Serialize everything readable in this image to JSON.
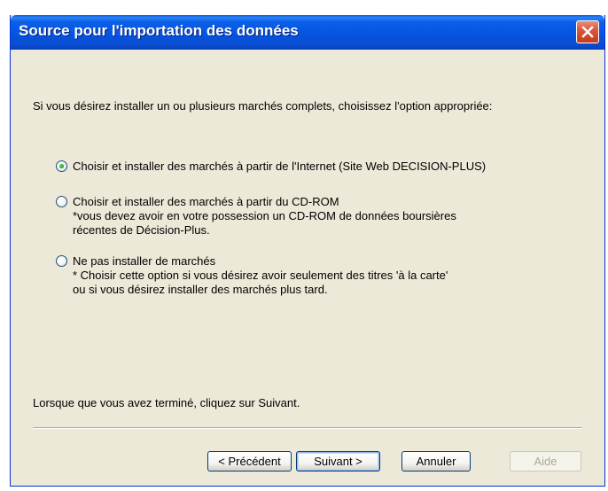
{
  "window": {
    "title": "Source pour l'importation des données"
  },
  "intro_text": "Si vous désirez installer un ou plusieurs marchés complets, choisissez l'option appropriée:",
  "options": [
    {
      "label": "Choisir et installer des marchés à partir de l'Internet (Site Web DECISION-PLUS)",
      "checked": true,
      "notes": []
    },
    {
      "label": "Choisir et installer des marchés à partir du CD-ROM",
      "checked": false,
      "notes": [
        "*vous devez avoir en votre possession un CD-ROM de données boursières",
        "récentes de Décision-Plus."
      ]
    },
    {
      "label": "Ne pas installer de marchés",
      "checked": false,
      "notes": [
        "* Choisir cette option si vous désirez avoir seulement des titres 'à la carte'",
        "ou si vous désirez installer des marchés plus tard."
      ]
    }
  ],
  "footer_text": "Lorsque que vous avez terminé, cliquez sur Suivant.",
  "buttons": {
    "previous": "< Précédent",
    "next": "Suivant >",
    "cancel": "Annuler",
    "help": "Aide"
  },
  "colors": {
    "titlebar": "#0553de",
    "dialog_background": "#ece9d8",
    "close_button": "#d8593c",
    "radio_selected": "#21a121"
  },
  "icons": {
    "close": "close-icon"
  }
}
